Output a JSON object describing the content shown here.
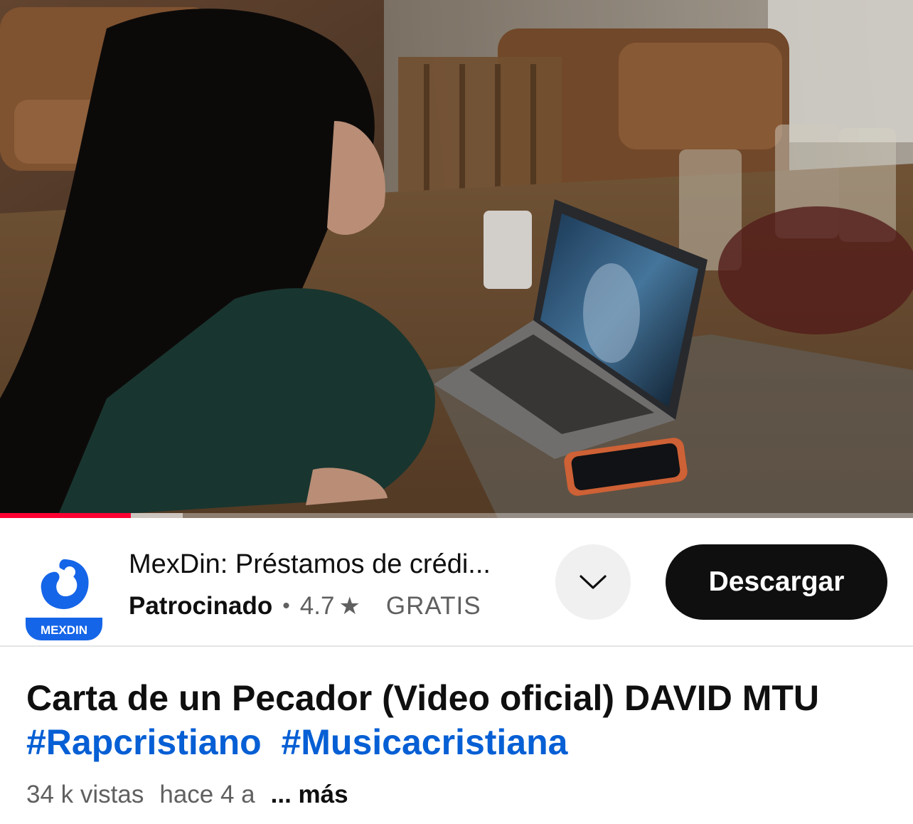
{
  "player": {
    "progress_played": 0.143,
    "progress_buffered": 0.2,
    "progress_color": "#ff0033"
  },
  "ad": {
    "logo_text": "MEXDIN",
    "title": "MexDin: Préstamos de crédi...",
    "sponsored_label": "Patrocinado",
    "separator": "•",
    "rating": "4.7",
    "star_icon": "★",
    "price": "GRATIS",
    "cta_label": "Descargar",
    "brand_color": "#1565e8"
  },
  "video": {
    "title": "Carta de un Pecador (Video oficial) DAVID MTU",
    "hashtags": [
      "#Rapcristiano",
      "#Musicacristiana"
    ],
    "views": "34 k vistas",
    "age": "hace 4 a",
    "more_label": "... más"
  }
}
